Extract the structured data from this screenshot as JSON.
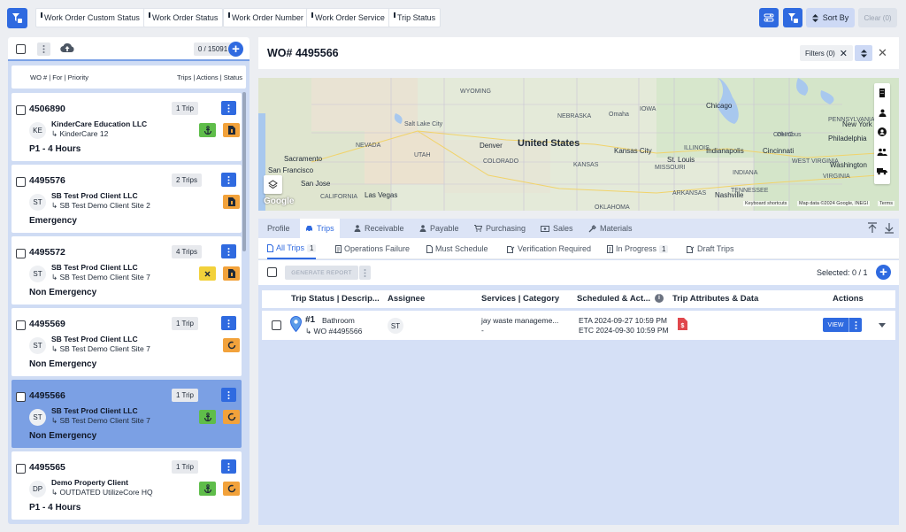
{
  "topbar": {
    "chips": [
      "Work Order Custom Status",
      "Work Order Status",
      "Work Order Number",
      "Work Order Service",
      "Trip Status"
    ],
    "sort_label": "Sort By",
    "clear_label": "Clear (0)"
  },
  "list": {
    "count": "0 / 15091",
    "col_left": "WO # | For | Priority",
    "col_right": "Trips | Actions | Status",
    "cards": [
      {
        "wo": "4506890",
        "trips": "1 Trip",
        "initials": "KE",
        "client": "KinderCare Education LLC",
        "site": "↳ KinderCare 12",
        "priority": "P1 - 4 Hours",
        "actions": [
          "anchor-green",
          "doc-orange"
        ],
        "selected": false
      },
      {
        "wo": "4495576",
        "trips": "2 Trips",
        "initials": "ST",
        "client": "SB Test Prod Client LLC",
        "site": "↳ SB Test Demo Client Site 2",
        "priority": "Emergency",
        "actions": [
          "doc-orange"
        ],
        "selected": false
      },
      {
        "wo": "4495572",
        "trips": "4 Trips",
        "initials": "ST",
        "client": "SB Test Prod Client LLC",
        "site": "↳ SB Test Demo Client Site 7",
        "priority": "Non Emergency",
        "actions": [
          "x-yellow",
          "doc-orange"
        ],
        "selected": false
      },
      {
        "wo": "4495569",
        "trips": "1 Trip",
        "initials": "ST",
        "client": "SB Test Prod Client LLC",
        "site": "↳ SB Test Demo Client Site 7",
        "priority": "Non Emergency",
        "actions": [
          "ring-orange"
        ],
        "selected": false
      },
      {
        "wo": "4495566",
        "trips": "1 Trip",
        "initials": "ST",
        "client": "SB Test Prod Client LLC",
        "site": "↳ SB Test Demo Client Site 7",
        "priority": "Non Emergency",
        "actions": [
          "anchor-green",
          "ring-orange"
        ],
        "selected": true
      },
      {
        "wo": "4495565",
        "trips": "1 Trip",
        "initials": "DP",
        "client": "Demo Property Client",
        "site": "↳ OUTDATED UtilizeCore HQ",
        "priority": "P1 - 4 Hours",
        "actions": [
          "anchor-green",
          "ring-orange"
        ],
        "selected": false
      }
    ]
  },
  "detail": {
    "title": "WO# 4495566",
    "filters_label": "Filters (0)",
    "map": {
      "big_label": "United States",
      "states": [
        "WYOMING",
        "NEBRASKA",
        "IOWA",
        "UTAH",
        "COLORADO",
        "KANSAS",
        "MISSOURI",
        "ILLINOIS",
        "INDIANA",
        "OHIO",
        "WEST VIRGINIA",
        "VIRGINIA",
        "KENTUCKY",
        "TENNESSEE",
        "ARKANSAS",
        "OKLAHOMA",
        "NEW MEXICO",
        "ARIZONA",
        "CALIFORNIA",
        "NEVADA",
        "PENNSYLVANIA",
        "ILLINOIS"
      ],
      "cities": [
        "Chicago",
        "Omaha",
        "Salt Lake City",
        "Denver",
        "Sacramento",
        "San Francisco",
        "San Jose",
        "Las Vegas",
        "Kansas City",
        "St. Louis",
        "Indianapolis",
        "Cincinnati",
        "Columbus",
        "Philadelphia",
        "Washington",
        "Nashville",
        "New York"
      ],
      "google": "Google",
      "shortcuts": "Keyboard shortcuts",
      "mapdata": "Map data ©2024 Google, INEGI",
      "terms": "Terms"
    },
    "tabs": [
      "Profile",
      "Trips",
      "Receivable",
      "Payable",
      "Purchasing",
      "Sales",
      "Materials"
    ],
    "subtabs": [
      {
        "label": "All Trips",
        "count": "1"
      },
      {
        "label": "Operations Failure",
        "count": ""
      },
      {
        "label": "Must Schedule",
        "count": ""
      },
      {
        "label": "Verification Required",
        "count": ""
      },
      {
        "label": "In Progress",
        "count": "1"
      },
      {
        "label": "Draft Trips",
        "count": ""
      }
    ],
    "generate_label": "GENERATE REPORT",
    "selected_label": "Selected: 0 / 1",
    "columns": [
      "Trip Status | Descrip...",
      "Assignee",
      "Services | Category",
      "Scheduled & Act...",
      "Trip Attributes & Data",
      "Actions"
    ],
    "rows": [
      {
        "num": "#1",
        "desc": "Bathroom",
        "wo": "↳ WO #4495566",
        "assignee": "ST",
        "service": "jay waste manageme...",
        "category": "-",
        "eta": "ETA 2024-09-27 10:59 PM",
        "etc": "ETC 2024-09-30 10:59 PM",
        "view": "VIEW"
      }
    ]
  }
}
